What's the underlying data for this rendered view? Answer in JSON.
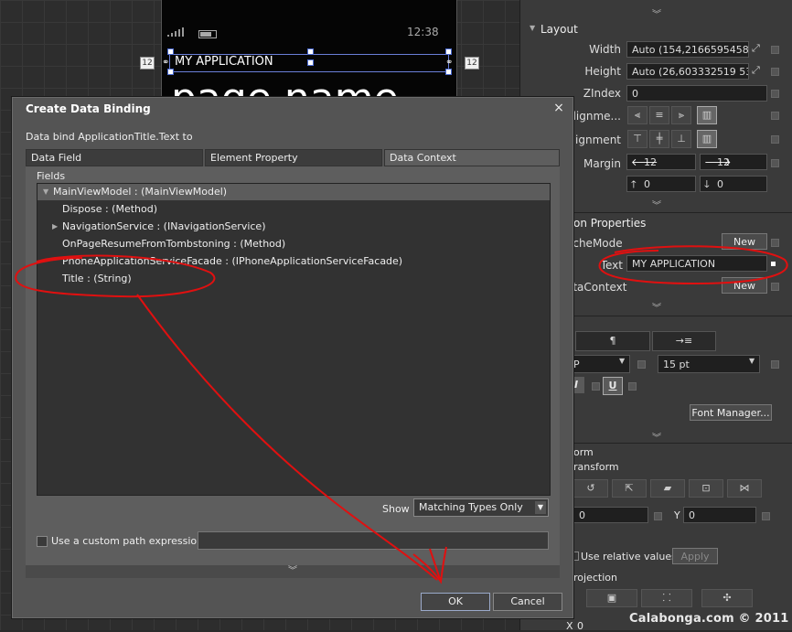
{
  "designer": {
    "status_time": "12:38",
    "app_title": "MY APPLICATION",
    "page_name": "page name",
    "margin_left": "12",
    "margin_right": "12"
  },
  "properties": {
    "layout_header": "Layout",
    "width_label": "Width",
    "width_value": "Auto (154,2166595458...",
    "height_label": "Height",
    "height_value": "Auto (26,603332519 53...",
    "zindex_label": "ZIndex",
    "zindex_value": "0",
    "halign_label": "lAlignme...",
    "valign_label": "Alignment",
    "margin_label": "Margin",
    "margin_left": "12",
    "margin_right": "12",
    "margin_top": "0",
    "margin_bottom": "0",
    "common_header": "on Properties",
    "cachemode_label": "acheMode",
    "new_button": "New",
    "text_label": "Text",
    "text_value": "MY APPLICATION",
    "datacontext_label": "ataContext",
    "new_button2": "New",
    "text_tab_para": "¶",
    "text_tab_indent": "→≡",
    "font_family_value": "P",
    "font_size_value": "15 pt",
    "italic_label": "I",
    "underline_label": "U",
    "font_manager_button": "Font Manager...",
    "transform_header": "orm",
    "render_transform_label": "ransform",
    "x_value": "0",
    "y_label": "Y",
    "y_value": "0",
    "relative_label": "Use relative values",
    "apply_button": "Apply",
    "projection_header": "rojection",
    "bottom_x_label": "X",
    "bottom_x_value": "0"
  },
  "dialog": {
    "title": "Create Data Binding",
    "close": "×",
    "prompt": "Data bind ApplicationTitle.Text to",
    "tabs": [
      "Data Field",
      "Element Property",
      "Data Context"
    ],
    "fields_label": "Fields",
    "tree": [
      {
        "label": "MainViewModel : (MainViewModel)",
        "expanded": true
      },
      {
        "label": "Dispose : (Method)"
      },
      {
        "label": "NavigationService : (INavigationService)",
        "collapsed": true
      },
      {
        "label": "OnPageResumeFromTombstoning : (Method)"
      },
      {
        "label": "PhoneApplicationServiceFacade : (IPhoneApplicationServiceFacade)"
      },
      {
        "label": "Title : (String)"
      }
    ],
    "show_label": "Show",
    "show_value": "Matching Types Only",
    "custom_path_label": "Use a custom path expression",
    "ok_button": "OK",
    "cancel_button": "Cancel"
  },
  "watermark": "Calabonga.com © 2011",
  "colors": {
    "annotation": "#e01010",
    "selection": "#6a7fd8"
  }
}
